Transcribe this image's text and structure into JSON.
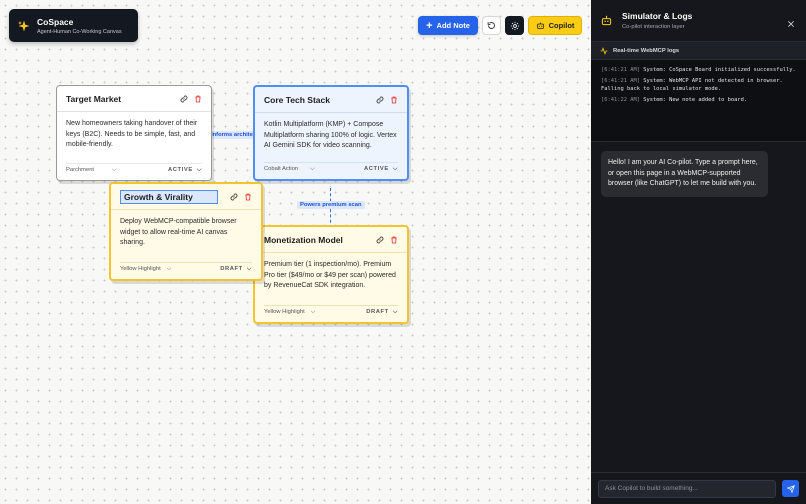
{
  "brand": {
    "title": "CoSpace",
    "subtitle": "Agent-Human Co-Working Canvas"
  },
  "toolbar": {
    "add_note": "Add Note",
    "copilot": "Copilot"
  },
  "notes": [
    {
      "title": "Target Market",
      "body": "New homeowners taking handover of their keys (B2C). Needs to be simple, fast, and mobile-friendly.",
      "theme": "Parchment",
      "status": "ACTIVE"
    },
    {
      "title": "Core Tech Stack",
      "body": "Kotlin Multiplatform (KMP) + Compose Multiplatform sharing 100% of logic. Vertex AI Gemini SDK for video scanning.",
      "theme": "Cobalt Action",
      "status": "ACTIVE"
    },
    {
      "title": "Growth & Virality",
      "body": "Deploy WebMCP-compatible browser widget to allow real-time AI canvas sharing.",
      "theme": "Yellow Highlight",
      "status": "DRAFT"
    },
    {
      "title": "Monetization Model",
      "body": "Premium tier (1 inspection/mo). Premium Pro tier ($49/mo or $49 per scan) powered by RevenueCat SDK integration.",
      "theme": "Yellow Highlight",
      "status": "DRAFT"
    }
  ],
  "edges": {
    "informs": "Informs architect",
    "powers": "Powers premium scan"
  },
  "panel": {
    "title": "Simulator & Logs",
    "subtitle": "Co-pilot interaction layer",
    "logs_header": "Real-time WebMCP logs",
    "logs": [
      {
        "ts": "[6:41:21 AM]",
        "msg": "System: CoSpace Board initialized successfully."
      },
      {
        "ts": "[6:41:21 AM]",
        "msg": "System: WebMCP API not detected in browser. Falling back to local simulator mode."
      },
      {
        "ts": "[6:41:22 AM]",
        "msg": "System: New note added to board."
      }
    ],
    "chat_message": "Hello! I am your AI Co-pilot. Type a prompt here, or open this page in a WebMCP-supported browser (like ChatGPT) to let me build with you.",
    "input_placeholder": "Ask Copilot to build something..."
  },
  "colors": {
    "accent": "#2563eb",
    "copilot": "#facc15",
    "cobalt": "#4f8ef7",
    "yellow": "#f4c430"
  }
}
